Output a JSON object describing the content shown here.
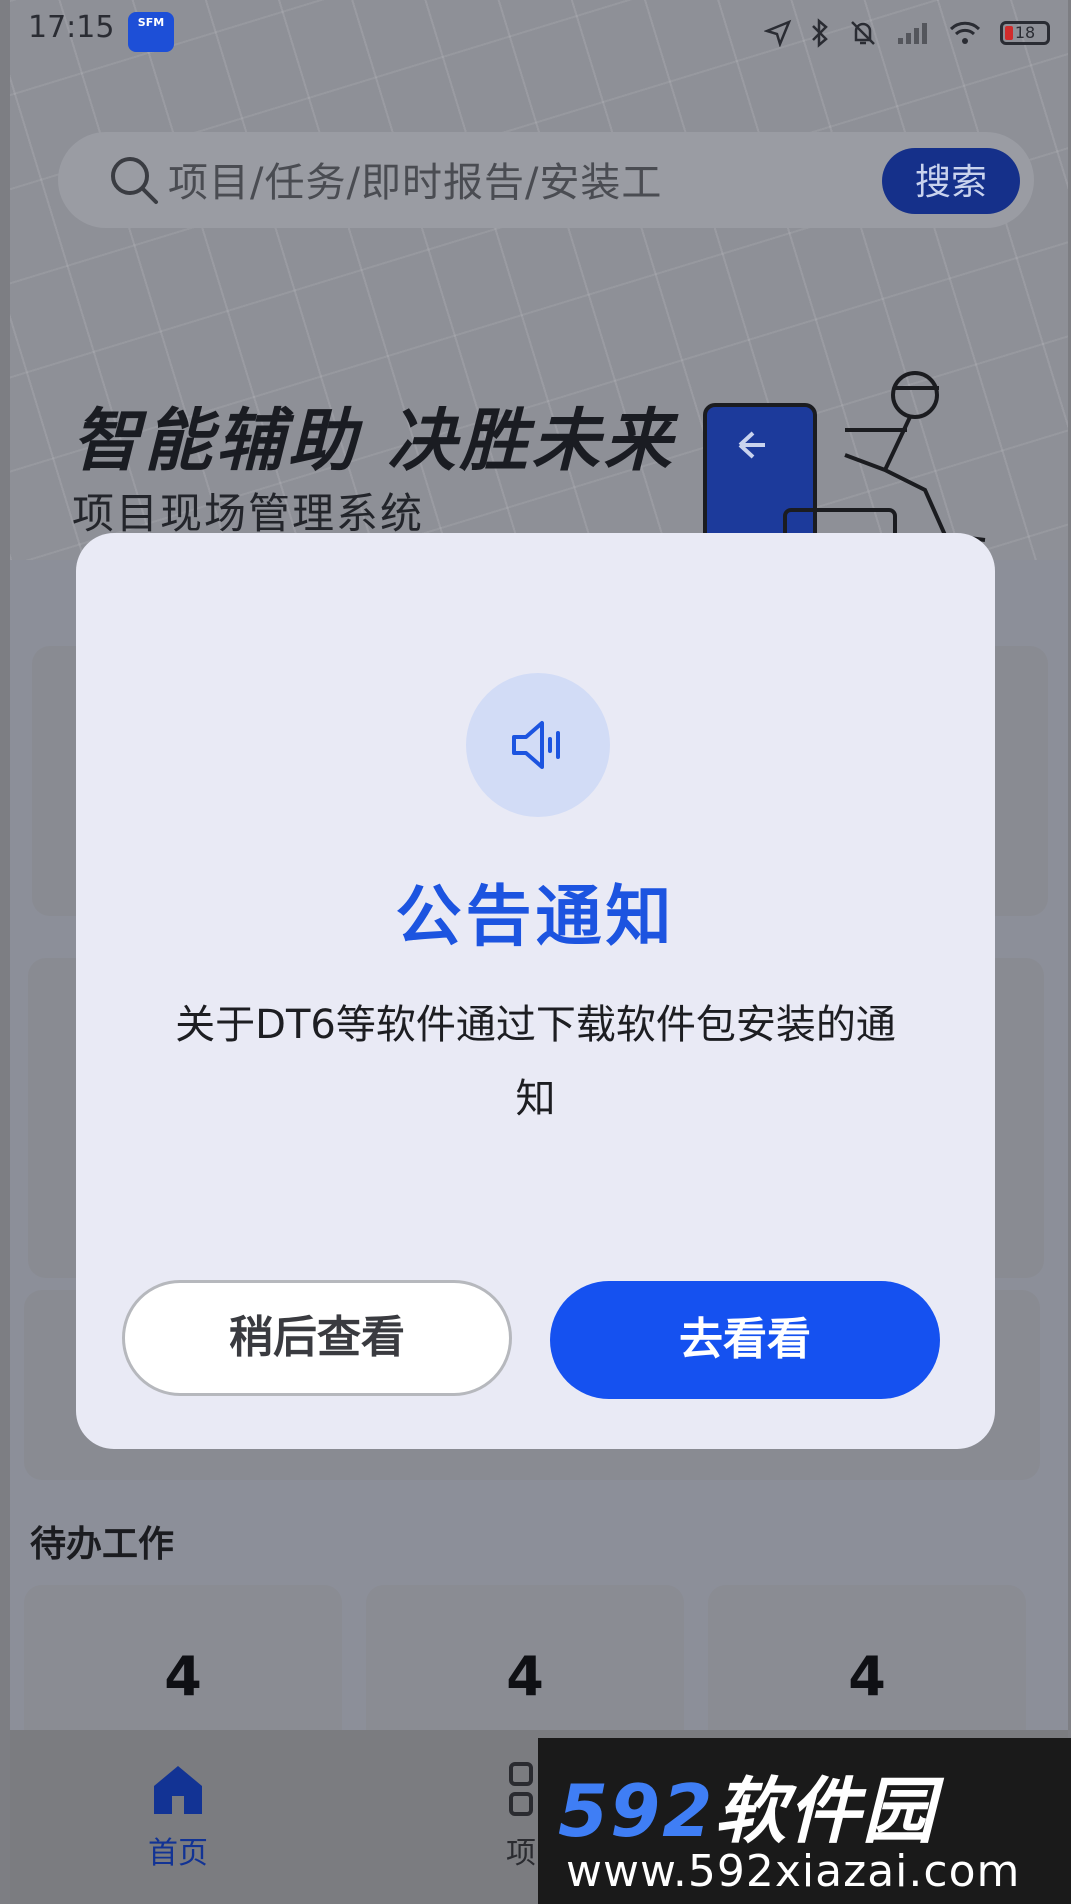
{
  "status": {
    "time": "17:15",
    "app_badge": "SFM",
    "battery": "18"
  },
  "search": {
    "placeholder": "项目/任务/即时报告/安装工",
    "button": "搜索"
  },
  "banner": {
    "title": "智能辅助 决胜未来",
    "subtitle": "项目现场管理系统"
  },
  "todo": {
    "heading": "待办工作",
    "counts": [
      "4",
      "4",
      "4"
    ]
  },
  "tabs": [
    {
      "label": "首页",
      "icon": "home-icon",
      "active": true
    },
    {
      "label": "项目",
      "icon": "grid-icon",
      "active": false
    }
  ],
  "modal": {
    "icon": "speaker-icon",
    "title": "公告通知",
    "message": "关于DT6等软件通过下载软件包安装的通知",
    "later_button": "稍后查看",
    "go_button": "去看看"
  },
  "watermark": {
    "brand_num": "592",
    "brand_cn": "软件园",
    "url": "www.592xiazai.com"
  },
  "colors": {
    "accent": "#1551f0",
    "title_blue": "#1c54e0",
    "icon_circle": "#d2dcf6"
  }
}
